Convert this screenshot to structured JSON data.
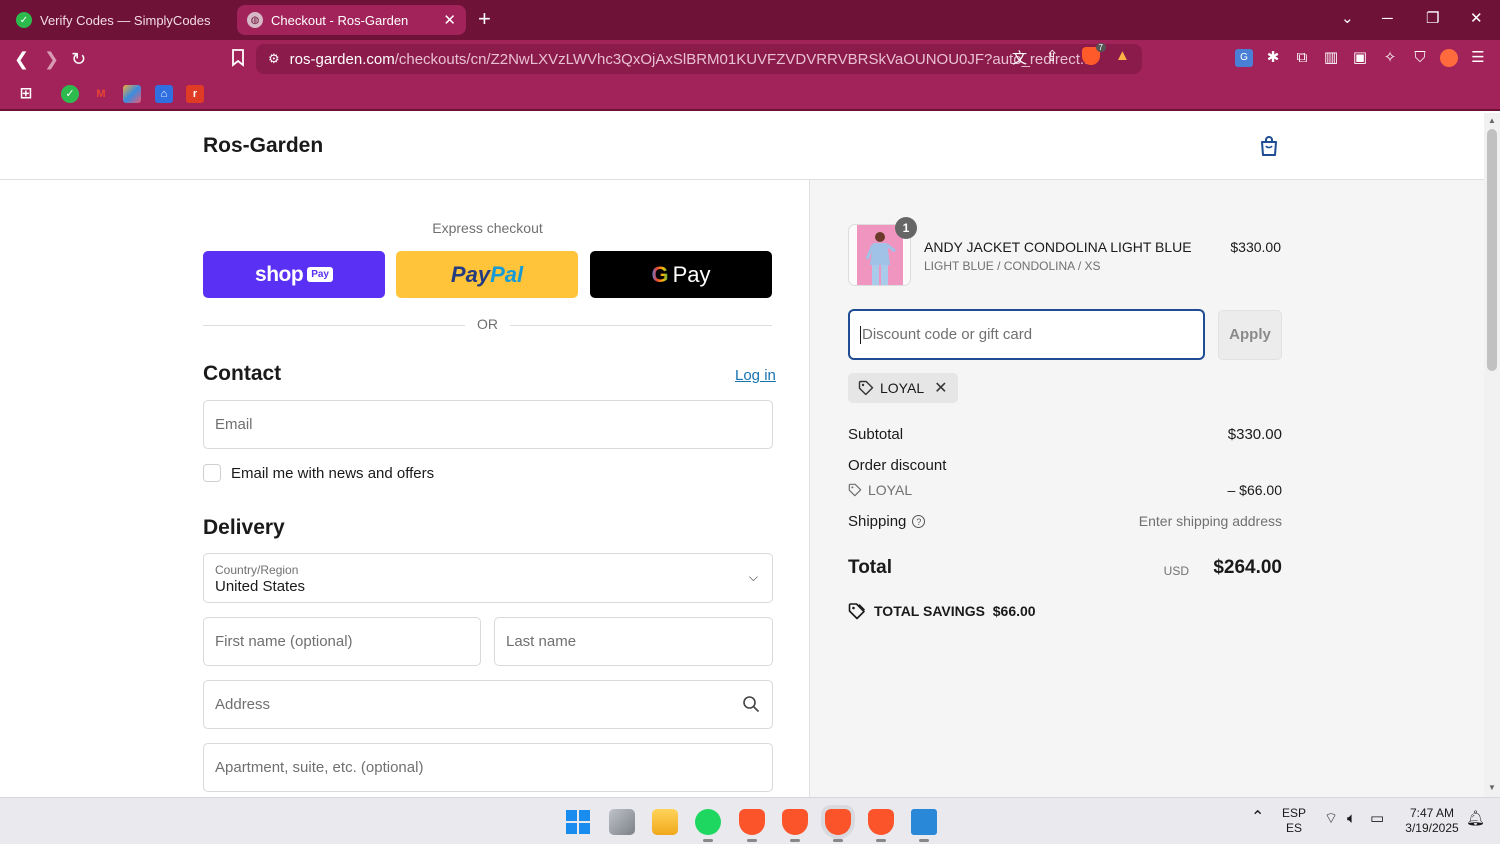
{
  "browser": {
    "tabs": [
      {
        "title": "Verify Codes — SimplyCodes",
        "active": false
      },
      {
        "title": "Checkout - Ros-Garden",
        "active": true
      }
    ],
    "url_host": "ros-garden.com",
    "url_path": "/checkouts/cn/Z2NwLXVzLWVhc3QxOjAxSlBRM01KUVFZVDVRRVBRSkVaOUNOU0JF?auto_redirect...",
    "shield_count": "7"
  },
  "store": {
    "name": "Ros-Garden"
  },
  "express": {
    "title": "Express checkout",
    "shop_label": "shop",
    "shop_pay_badge": "Pay",
    "paypal_left": "Pay",
    "paypal_right": "Pal",
    "gpay_g": "G",
    "gpay_label": "Pay",
    "or_label": "OR"
  },
  "contact": {
    "heading": "Contact",
    "login_label": "Log in",
    "email_placeholder": "Email",
    "newsletter_label": "Email me with news and offers"
  },
  "delivery": {
    "heading": "Delivery",
    "country_label": "Country/Region",
    "country_value": "United States",
    "first_name_placeholder": "First name (optional)",
    "last_name_placeholder": "Last name",
    "address_placeholder": "Address",
    "apartment_placeholder": "Apartment, suite, etc. (optional)"
  },
  "summary": {
    "product": {
      "quantity": "1",
      "name": "ANDY JACKET CONDOLINA LIGHT BLUE",
      "variant": "LIGHT BLUE / CONDOLINA / XS",
      "price": "$330.00"
    },
    "discount_placeholder": "Discount code or gift card",
    "apply_label": "Apply",
    "applied_code": "LOYAL",
    "subtotal_label": "Subtotal",
    "subtotal_value": "$330.00",
    "order_discount_label": "Order discount",
    "discount_code": "LOYAL",
    "discount_value": "– $66.00",
    "shipping_label": "Shipping",
    "shipping_value": "Enter shipping address",
    "total_label": "Total",
    "total_currency": "USD",
    "total_value": "$264.00",
    "savings_label": "TOTAL SAVINGS",
    "savings_value": "$66.00"
  },
  "taskbar": {
    "lang_top": "ESP",
    "lang_bottom": "ES",
    "time": "7:47 AM",
    "date": "3/19/2025"
  },
  "colors": {
    "chrome_dark": "#6e1337",
    "chrome": "#a2235a",
    "shop_pay": "#5a31f4",
    "paypal": "#ffc439",
    "link": "#1773b0",
    "focus": "#1f4d93"
  }
}
